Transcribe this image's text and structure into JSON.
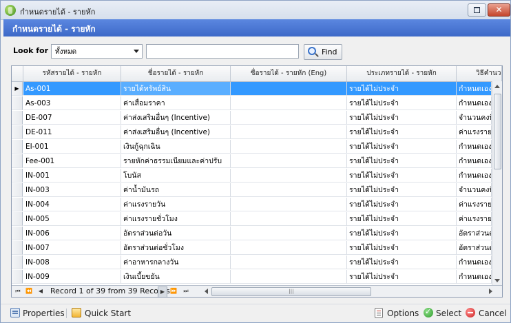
{
  "window": {
    "title": "กำหนดรายได้ - รายหัก",
    "close_glyph": "✕"
  },
  "header": {
    "title": "กำหนดรายได้ - รายหัก"
  },
  "search": {
    "label": "Look for",
    "filter_value": "ทั้งหมด",
    "text_value": "",
    "find_label": "Find"
  },
  "grid": {
    "columns": [
      "รหัสรายได้ - รายหัก",
      "ชื่อรายได้ - รายหัก",
      "ชื่อรายได้ - รายหัก (Eng)",
      "ประเภทรายได้ - รายหัก",
      "วิธีคำนวณ"
    ],
    "selected_row": 0,
    "row_marker": "▶",
    "rows": [
      {
        "code": "As-001",
        "name": "รายได้ทรัพย์สิน",
        "name_eng": "",
        "type": "รายได้ไม่ประจำ",
        "method": "กำหนดเอง"
      },
      {
        "code": "As-003",
        "name": "ค่าเสื่อมราคา",
        "name_eng": "",
        "type": "รายได้ไม่ประจำ",
        "method": "กำหนดเอง"
      },
      {
        "code": "DE-007",
        "name": "ค่าส่งเสริมอื่นๆ (Incentive)",
        "name_eng": "",
        "type": "รายได้ไม่ประจำ",
        "method": "จำนวนคงที่"
      },
      {
        "code": "DE-011",
        "name": "ค่าส่งเสริมอื่นๆ (Incentive)",
        "name_eng": "",
        "type": "รายได้ไม่ประจำ",
        "method": "ค่าแรงรายวัน"
      },
      {
        "code": "EI-001",
        "name": "เงินกู้ฉุกเฉิน",
        "name_eng": "",
        "type": "รายได้ไม่ประจำ",
        "method": "กำหนดเอง"
      },
      {
        "code": "Fee-001",
        "name": "รายหักค่าธรรมเนียมและค่าปรับ",
        "name_eng": "",
        "type": "รายได้ไม่ประจำ",
        "method": "กำหนดเอง"
      },
      {
        "code": "IN-001",
        "name": "โบนัส",
        "name_eng": "",
        "type": "รายได้ไม่ประจำ",
        "method": "กำหนดเอง"
      },
      {
        "code": "IN-003",
        "name": "ค่าน้ำมันรถ",
        "name_eng": "",
        "type": "รายได้ไม่ประจำ",
        "method": "จำนวนคงที่"
      },
      {
        "code": "IN-004",
        "name": "ค่าแรงรายวัน",
        "name_eng": "",
        "type": "รายได้ไม่ประจำ",
        "method": "ค่าแรงรายวัน"
      },
      {
        "code": "IN-005",
        "name": "ค่าแรงรายชั่วโมง",
        "name_eng": "",
        "type": "รายได้ไม่ประจำ",
        "method": "ค่าแรงรายชั่วโมง"
      },
      {
        "code": "IN-006",
        "name": "อัตราส่วนต่อวัน",
        "name_eng": "",
        "type": "รายได้ไม่ประจำ",
        "method": "อัตราส่วนต่อวัน"
      },
      {
        "code": "IN-007",
        "name": "อัตราส่วนต่อชั่วโมง",
        "name_eng": "",
        "type": "รายได้ไม่ประจำ",
        "method": "อัตราส่วนต่อชั่วโมง"
      },
      {
        "code": "IN-008",
        "name": "ค่าอาหารกลางวัน",
        "name_eng": "",
        "type": "รายได้ไม่ประจำ",
        "method": "กำหนดเอง"
      },
      {
        "code": "IN-009",
        "name": "เงินเบี้ยขยัน",
        "name_eng": "",
        "type": "รายได้ไม่ประจำ",
        "method": "กำหนดเอง"
      }
    ],
    "navigator": {
      "first": "⏮",
      "prev_page": "⏪",
      "prev": "◀",
      "record_text": "Record 1 of 39 from 39 Records",
      "next": "▶",
      "next_page": "⏩",
      "last": "⏭",
      "hscroll_grip": "|||"
    }
  },
  "footer": {
    "properties": "Properties",
    "quick_start": "Quick Start",
    "options": "Options",
    "select": "Select",
    "cancel": "Cancel"
  }
}
